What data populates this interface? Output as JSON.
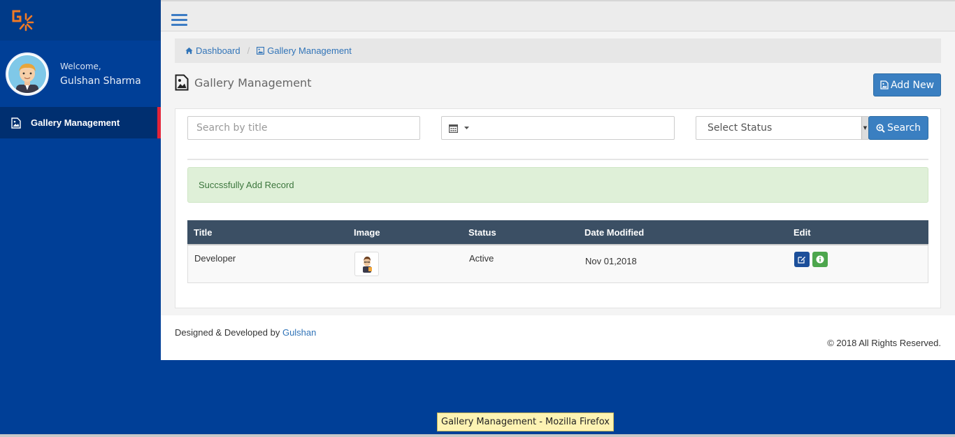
{
  "sidebar": {
    "logo": "logo-icon",
    "welcome_label": "Welcome,",
    "user_name": "Gulshan Sharma",
    "menu": [
      {
        "label": "Gallery Management",
        "icon": "image-file-icon",
        "active": true
      }
    ],
    "active_accent": "#e32338"
  },
  "header": {
    "menu_icon": "hamburger-icon"
  },
  "breadcrumb": {
    "items": [
      {
        "label": "Dashboard",
        "icon": "home-icon"
      },
      {
        "label": "Gallery Management",
        "icon": "image-icon"
      }
    ]
  },
  "page": {
    "title": "Gallery Management",
    "add_button": "Add New"
  },
  "filters": {
    "search_placeholder": "Search by title",
    "date_value": "",
    "status_selected": "Select Status",
    "search_button": "Search"
  },
  "alert": {
    "message": "Succssfully Add Record"
  },
  "table": {
    "columns": [
      "Title",
      "Image",
      "Status",
      "Date Modified",
      "Edit"
    ],
    "rows": [
      {
        "title": "Developer",
        "image": "developer-avatar-thumbnail",
        "status": "Active",
        "date_modified": "Nov 01,2018"
      }
    ]
  },
  "footer": {
    "designed_by_prefix": "Designed & Developed by",
    "designed_by_link": "Gulshan",
    "copyright": "© 2018 All Rights Reserved."
  },
  "tooltip": {
    "text": "Gallery Management - Mozilla Firefox"
  },
  "colors": {
    "sidebar_bg": "#003f97",
    "primary_button": "#3a7fc1",
    "table_header": "#3b4f64",
    "alert_bg": "#dff0d8",
    "edit_button": "#1c4f9a",
    "info_button": "#4da64d",
    "logo_orange": "#f27a24"
  }
}
